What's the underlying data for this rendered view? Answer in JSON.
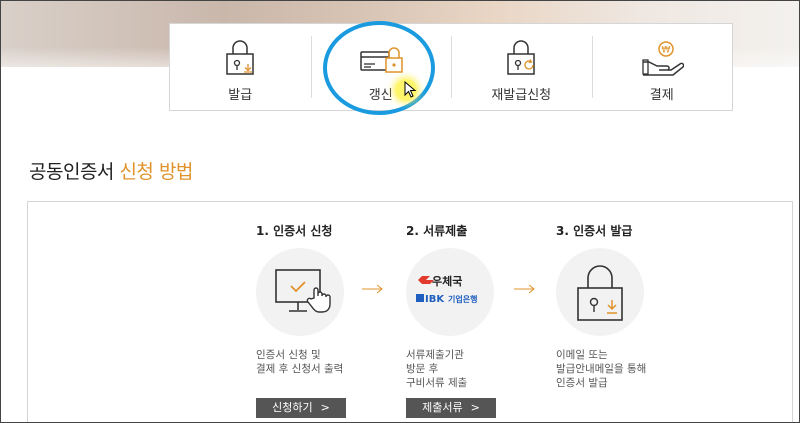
{
  "tabs": [
    {
      "label": "발급",
      "icon": "lock-download-icon"
    },
    {
      "label": "갱신",
      "icon": "card-lock-icon"
    },
    {
      "label": "재발급신청",
      "icon": "lock-refresh-icon"
    },
    {
      "label": "결제",
      "icon": "hand-coin-icon"
    }
  ],
  "section": {
    "title_plain": "공동인증서 ",
    "title_accent": "신청 방법"
  },
  "steps": [
    {
      "title": "1. 인증서 신청",
      "desc": [
        "인증서 신청 및",
        "결제 후 신청서 출력"
      ],
      "button": "신청하기",
      "icon": "monitor-click-icon"
    },
    {
      "title": "2. 서류제출",
      "desc": [
        "서류제출기관",
        "방문 후",
        "구비서류 제출"
      ],
      "button": "제출서류",
      "icon": "post-bank-logo",
      "logos": {
        "post": "우체국",
        "bank_abbr": "IBK",
        "bank": "기업은행"
      }
    },
    {
      "title": "3. 인증서 발급",
      "desc": [
        "이메일 또는",
        "발급안내메일을 통해",
        "인증서 발급"
      ],
      "icon": "lock-download-icon"
    }
  ],
  "colors": {
    "accent": "#e0932b",
    "highlight": "#1a9be0",
    "button": "#555555"
  }
}
